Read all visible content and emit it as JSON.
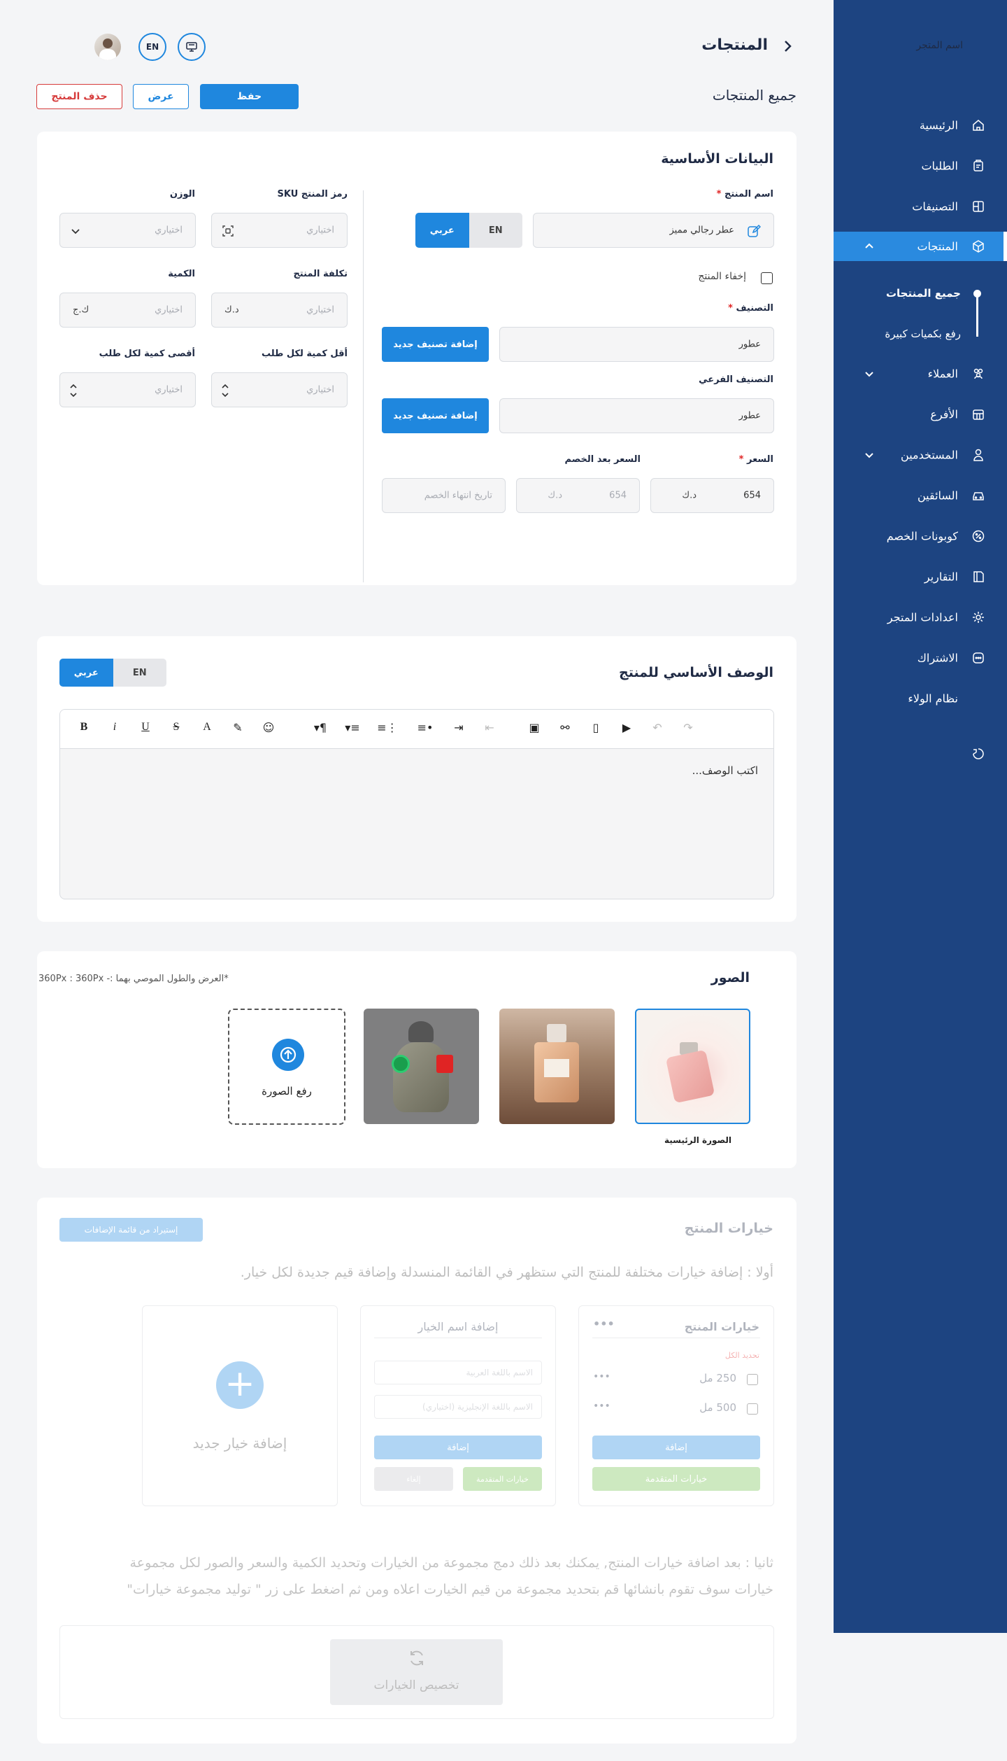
{
  "header": {
    "page_title": "المنتجات",
    "store_name": "اسم المتجر",
    "lang_btn": "EN",
    "breadcrumb": "جميع المنتجات",
    "save": "حفظ",
    "view": "عرض",
    "delete": "حذف المنتج"
  },
  "sidebar": {
    "items": [
      {
        "label": "الرئيسية",
        "icon": "home-icon"
      },
      {
        "label": "الطلبات",
        "icon": "orders-icon"
      },
      {
        "label": "التصنيفات",
        "icon": "categories-icon"
      },
      {
        "label": "المنتجات",
        "icon": "box-icon"
      },
      {
        "label": "العملاء",
        "icon": "customers-icon"
      },
      {
        "label": "الأفرع",
        "icon": "branches-icon"
      },
      {
        "label": "المستخدمين",
        "icon": "user-icon"
      },
      {
        "label": "السائقين",
        "icon": "car-icon"
      },
      {
        "label": "كوبونات الخصم",
        "icon": "coupon-icon"
      },
      {
        "label": "التقارير",
        "icon": "reports-icon"
      },
      {
        "label": "اعدادات المتجر",
        "icon": "settings-icon"
      },
      {
        "label": "الاشتراك",
        "icon": "subscription-icon"
      },
      {
        "label": "نظام الولاء",
        "icon": ""
      }
    ],
    "sub_items": [
      "جميع المنتجات",
      "رفع بكميات كبيرة"
    ]
  },
  "basic": {
    "title": "البيانات الأساسية",
    "name_label": "اسم المنتج",
    "name_value": "عطر رجالي مميز",
    "lang_ar": "عربي",
    "lang_en": "EN",
    "hide_label": "إخفاء المنتج",
    "category_label": "التصنيف",
    "category_value": "عطور",
    "add_category": "إضافة تصنيف جديد",
    "subcategory_label": "التصنيف الفرعي",
    "subcategory_value": "عطور",
    "price_label": "السعر",
    "price_value": "654",
    "currency": "د.ك",
    "discount_label": "السعر بعد الخصم",
    "discount_value": "654",
    "discount_end_ph": "تاريخ انتهاء الخصم",
    "sku_label": "رمز المنتج SKU",
    "weight_label": "الوزن",
    "cost_label": "تكلفة المنتج",
    "qty_label": "الكمية",
    "min_label": "أقل كمية لكل طلب",
    "max_label": "أقصى كمية لكل طلب",
    "optional": "اختياري",
    "qty_unit": "ك.ج"
  },
  "description": {
    "title": "الوصف الأساسي للمنتج",
    "lang_ar": "عربي",
    "lang_en": "EN",
    "placeholder": "اكتب الوصف..."
  },
  "images": {
    "title": "الصور",
    "hint": "*العرض والطول الموصي بهما :- 360Px : 360Px",
    "main_caption": "الصورة الرئيسية",
    "upload": "رفع الصورة"
  },
  "options": {
    "title": "خيارات المنتج",
    "import_btn": "إستيراد من قائمة الإضافات",
    "step1": "أولا : إضافة خيارات مختلفة للمنتج التي ستظهر في القائمة المنسدلة وإضافة قيم جديدة لكل خيار.",
    "card1_title": "خيارات المنتج",
    "select_all": "تحديد الكل",
    "opt1": "250 مل",
    "opt2": "500 مل",
    "add": "إضافة",
    "advanced": "خيارات المتقدمة",
    "card2_title": "إضافة اسم الخيار",
    "name_ar_ph": "الاسم باللغة العربية",
    "name_en_ph": "الاسم باللغة الإنجليزية (اختياري)",
    "cancel": "إلغاء",
    "add_new": "إضافة خيار جديد",
    "step2_line1": "ثانيا : بعد اضافة خيارات المنتج, يمكنك بعد ذلك دمج مجموعة من الخيارات وتحديد الكمية والسعر والصور لكل مجموعة",
    "step2_line2": "خيارات سوف تقوم بانشائها قم بتحديد مجموعة من قيم الخيارت اعلاه ومن ثم اضغط على زر \" توليد مجموعة خيارات\"",
    "customize": "تخصيص الخيارات"
  }
}
